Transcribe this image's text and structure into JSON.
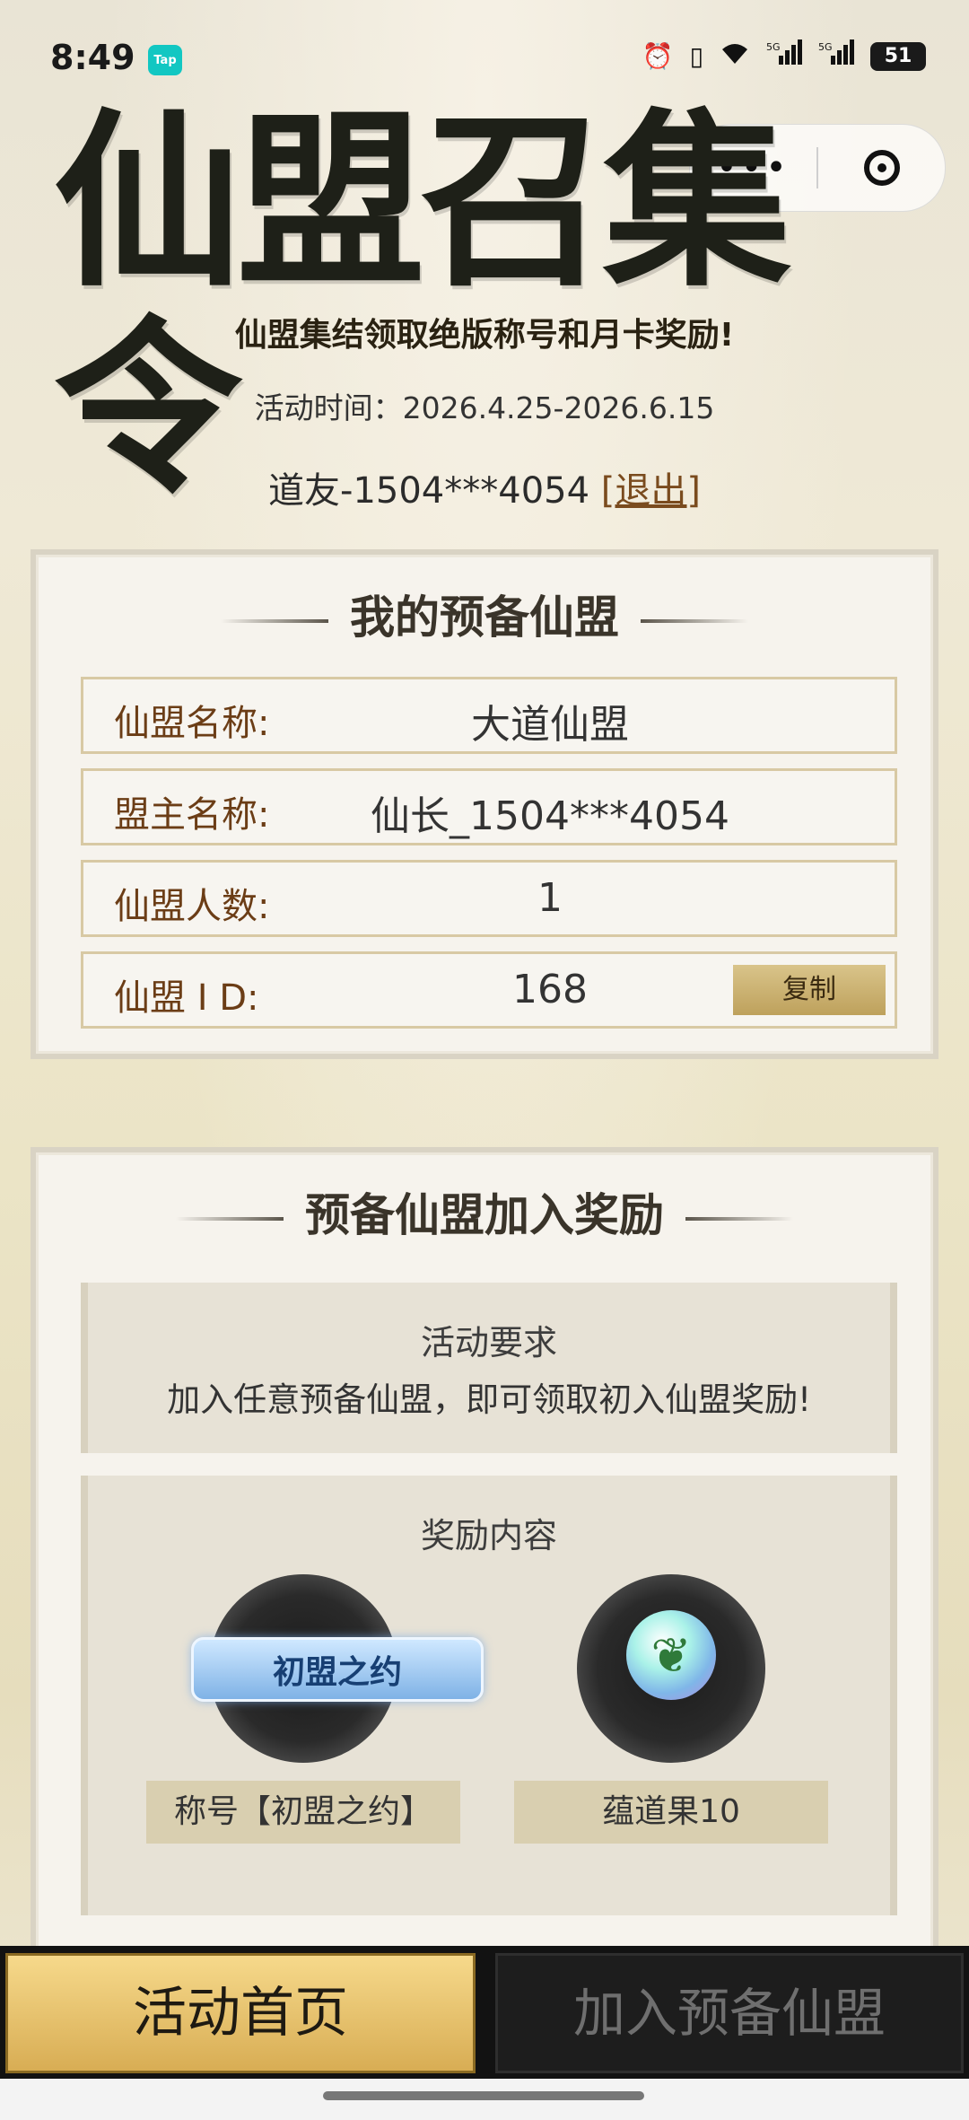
{
  "status_bar": {
    "time": "8:49",
    "badge": "Tap",
    "battery": "51",
    "icons": [
      "alarm-icon",
      "vibrate-icon",
      "wifi-icon",
      "signal-5g-icon",
      "signal-5g-icon"
    ]
  },
  "capsule": {
    "more": "•••"
  },
  "banner": {
    "title": "仙盟召集令",
    "subtitle": "仙盟集结领取绝版称号和月卡奖励!",
    "activity_time": "活动时间：2026.4.25-2026.6.15",
    "user": "道友-1504***4054",
    "logout": "[退出]"
  },
  "my_alliance": {
    "title": "我的预备仙盟",
    "rows": [
      {
        "label": "仙盟名称:",
        "value": "大道仙盟"
      },
      {
        "label": "盟主名称:",
        "value": "仙长_1504***4054"
      },
      {
        "label": "仙盟人数:",
        "value": "1"
      },
      {
        "label": "仙盟 I D:",
        "value": "168"
      }
    ],
    "copy_label": "复制"
  },
  "reward_section": {
    "title": "预备仙盟加入奖励",
    "requirement_title": "活动要求",
    "requirement_text": "加入任意预备仙盟，即可领取初入仙盟奖励!",
    "reward_title": "奖励内容",
    "rewards": [
      {
        "label": "称号【初盟之约】",
        "badge": "初盟之约"
      },
      {
        "label": "蕴道果10"
      }
    ]
  },
  "bottom_nav": {
    "home": "活动首页",
    "join": "加入预备仙盟"
  },
  "colors": {
    "accent_gold": "#d8ad54",
    "label_brown": "#6b3d16",
    "row_border": "#d8c9a4"
  }
}
